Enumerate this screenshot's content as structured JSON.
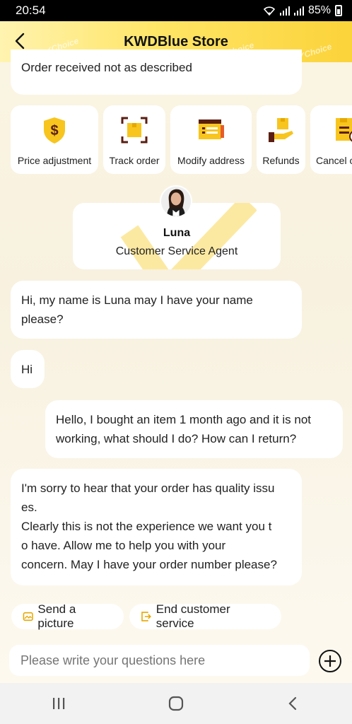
{
  "status_bar": {
    "time": "20:54",
    "battery": "85%"
  },
  "header": {
    "title": "KWDBlue Store",
    "watermark": "✓Choice"
  },
  "messages_top": {
    "text": "Order received not as described"
  },
  "quick_actions": [
    {
      "label": "Price adjustment",
      "icon": "dollar-shield-icon"
    },
    {
      "label": "Track order",
      "icon": "track-box-icon"
    },
    {
      "label": "Modify address",
      "icon": "address-card-icon"
    },
    {
      "label": "Refunds",
      "icon": "refund-hand-icon"
    },
    {
      "label": "Cancel o",
      "icon": "cancel-order-icon"
    }
  ],
  "agent": {
    "name": "Luna",
    "role": "Customer Service Agent"
  },
  "messages": [
    {
      "side": "agent",
      "text": "Hi, my name is Luna may I have your name please?"
    },
    {
      "side": "agent",
      "text": "Hi"
    },
    {
      "side": "user",
      "text": "Hello, I bought an item 1 month ago and it is not working, what should I do?  How can I return?"
    },
    {
      "side": "agent",
      "line1": "I'm sorry to hear that your order has quality issu",
      "line2": "es.",
      "line3": "Clearly this is not the experience we want you t",
      "line4": "o have.  Allow me to help you with your",
      "line5": "concern. May I have your order number please?"
    }
  ],
  "chips": {
    "send_picture": "Send a picture",
    "end_service": "End customer service"
  },
  "composer": {
    "placeholder": "Please write your questions here"
  },
  "colors": {
    "accent": "#f7c51e",
    "icon_dark": "#5a1e12"
  }
}
